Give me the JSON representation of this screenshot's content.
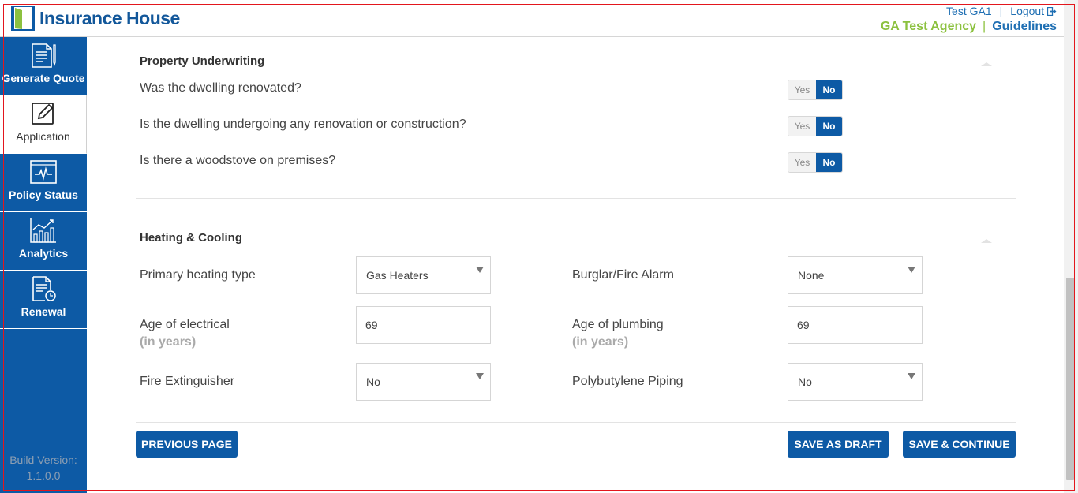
{
  "header": {
    "brand": "Insurance House",
    "user": "Test GA1",
    "separator": "|",
    "logout": "Logout",
    "agency": "GA Test Agency",
    "guidelines": "Guidelines"
  },
  "sidebar": {
    "items": [
      {
        "label": "Generate Quote",
        "icon": "document-list-icon"
      },
      {
        "label": "Application",
        "icon": "edit-icon"
      },
      {
        "label": "Policy Status",
        "icon": "monitor-pulse-icon"
      },
      {
        "label": "Analytics",
        "icon": "analytics-icon"
      },
      {
        "label": "Renewal",
        "icon": "document-clock-icon"
      }
    ],
    "build_label": "Build Version:",
    "build_version": "1.1.0.0"
  },
  "property": {
    "title": "Property Underwriting",
    "questions": [
      {
        "text": "Was the dwelling renovated?",
        "yes": "Yes",
        "no": "No",
        "selected": "No"
      },
      {
        "text": "Is the dwelling undergoing any renovation or construction?",
        "yes": "Yes",
        "no": "No",
        "selected": "No"
      },
      {
        "text": "Is there a woodstove on premises?",
        "yes": "Yes",
        "no": "No",
        "selected": "No"
      }
    ]
  },
  "heating": {
    "title": "Heating & Cooling",
    "primary_heating_label": "Primary heating type",
    "primary_heating_value": "Gas Heaters",
    "alarm_label": "Burglar/Fire Alarm",
    "alarm_value": "None",
    "electrical_label": "Age of electrical",
    "electrical_sub": "(in years)",
    "electrical_value": "69",
    "plumbing_label": "Age of plumbing",
    "plumbing_sub": "(in years)",
    "plumbing_value": "69",
    "extinguisher_label": "Fire Extinguisher",
    "extinguisher_value": "No",
    "piping_label": "Polybutylene Piping",
    "piping_value": "No"
  },
  "buttons": {
    "previous": "PREVIOUS PAGE",
    "draft": "SAVE AS DRAFT",
    "continue": "SAVE & CONTINUE"
  },
  "colors": {
    "primary": "#0d5aa5",
    "agency_green": "#8cc13f",
    "frame_red": "#e3161d"
  }
}
